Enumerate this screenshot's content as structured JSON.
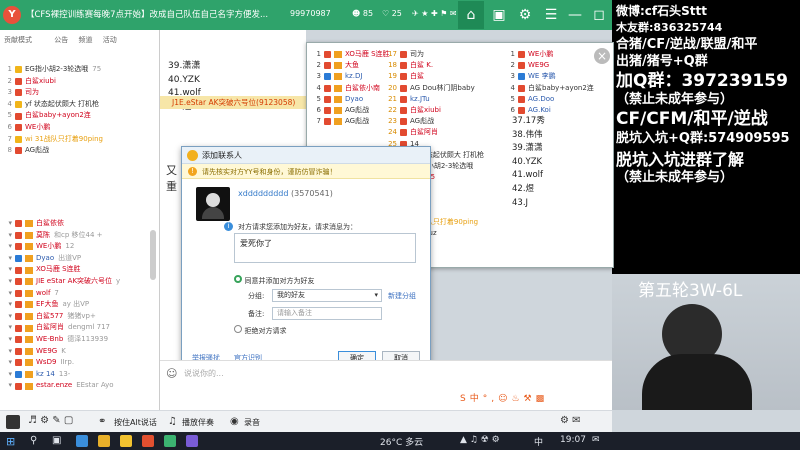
{
  "app": {
    "logo": "Y",
    "title": "【CFS裸控训练赛每晚7点开始】改成自己队伍自己名字方便发...",
    "channel_id": "99970987",
    "viewers": "85",
    "sub_count": "25"
  },
  "left_tabs": [
    "贡献模式",
    "公告",
    "频道",
    "活动"
  ],
  "left_top_rows": [
    {
      "rank": "1",
      "name": "EG指小胡2-3轮选哦",
      "extra": "75"
    },
    {
      "rank": "2",
      "name": "白鲨xiubi",
      "extra": ""
    },
    {
      "rank": "3",
      "name": "司为",
      "extra": ""
    },
    {
      "rank": "4",
      "name": "yf 状态起伏颇大 打机枪",
      "extra": ""
    },
    {
      "rank": "5",
      "name": "白鲨baby+ayon2连",
      "extra": ""
    },
    {
      "rank": "6",
      "name": "WE小鹏",
      "extra": ""
    },
    {
      "rank": "7",
      "name": "wi 31战队只打着90ping",
      "extra": ""
    },
    {
      "rank": "8",
      "name": "AG彪战",
      "extra": ""
    }
  ],
  "left_members": [
    {
      "name": "白鲨依依",
      "extra": ""
    },
    {
      "name": "莫陈",
      "extra": "和cp 移位44 +"
    },
    {
      "name": "WE小鹏",
      "extra": "12"
    },
    {
      "name": "Dyao",
      "extra": "出道VP"
    },
    {
      "name": "XO马鹿 S连胜",
      "extra": ""
    },
    {
      "name": "JIE eStar AK突破六号位",
      "extra": "y"
    },
    {
      "name": "wolf",
      "extra": "7"
    },
    {
      "name": "EF大鱼",
      "extra": "ay 出VP"
    },
    {
      "name": "白鲨577",
      "extra": "猪猪vp+"
    },
    {
      "name": "白鲨阿肖",
      "extra": "dengml 717"
    },
    {
      "name": "WE-Bnb",
      "extra": "德泽113939"
    },
    {
      "name": "WE9G",
      "extra": "K"
    },
    {
      "name": "WsD9",
      "extra": "IIrp."
    },
    {
      "name": "kz 14",
      "extra": "13-"
    },
    {
      "name": "estar.enze",
      "extra": "EEstar Ayo"
    }
  ],
  "chat": {
    "lines": [
      "39.潇潇",
      "40.YZK",
      "41.wolf",
      "42.煜"
    ],
    "highlight": "J1E.eStar AK突破六号位(9123058)",
    "side_text": [
      "又",
      "重"
    ]
  },
  "panel": {
    "col1": [
      {
        "n": "1",
        "name": "XO马鹿 S连胜"
      },
      {
        "n": "2",
        "name": "大鱼"
      },
      {
        "n": "3",
        "name": "kz.DJ"
      },
      {
        "n": "4",
        "name": "白鲨依小南"
      },
      {
        "n": "5",
        "name": "Dyao"
      },
      {
        "n": "6",
        "name": "AG彪战"
      },
      {
        "n": "7",
        "name": "AG彪战"
      }
    ],
    "col2": [
      {
        "n": "17",
        "name": "司为"
      },
      {
        "n": "18",
        "name": "白鲨 K."
      },
      {
        "n": "19",
        "name": "白鲨"
      },
      {
        "n": "20",
        "name": "AG Dou林门阴baby"
      },
      {
        "n": "21",
        "name": "kz.JTu"
      },
      {
        "n": "22",
        "name": "白鲨xiubi"
      },
      {
        "n": "23",
        "name": "AG彪战"
      },
      {
        "n": "24",
        "name": "白鲨阿肖"
      },
      {
        "n": "25",
        "name": "14"
      },
      {
        "n": "26",
        "name": "yf 状态起伏颇大 打机枪"
      },
      {
        "n": "27",
        "name": "EG指小胡2-3轮选哦"
      },
      {
        "n": "28",
        "name": "白鲨 15"
      },
      {
        "n": "29",
        "name": ""
      },
      {
        "n": "30",
        "name": ""
      },
      {
        "n": "31",
        "name": ""
      },
      {
        "n": "32",
        "name": "31战队只打着90ping"
      },
      {
        "n": "33",
        "name": "白鲨Ruz"
      },
      {
        "n": "34",
        "name": ""
      }
    ],
    "col3": [
      {
        "n": "1",
        "name": "WE小鹏"
      },
      {
        "n": "2",
        "name": "WE9G"
      },
      {
        "n": "3",
        "name": "WE 李鹏"
      },
      {
        "n": "4",
        "name": "白鲨baby+ayon2连"
      },
      {
        "n": "5",
        "name": "AG.Doo"
      },
      {
        "n": "6",
        "name": "AG.Koi"
      }
    ],
    "list": [
      "37.17秀",
      "38.伟伟",
      "39.潇潇",
      "40.YZK",
      "41.wolf",
      "42.煜",
      "43.J"
    ]
  },
  "stream": {
    "lines": [
      "微博:cf石头Sttt",
      "木友群:836325744",
      "合猪/CF/逆战/联盟/和平",
      "出猪/猪号+Q群",
      "加Q群：397239159",
      "（禁止未成年参与）",
      "CF/CFM/和平/逆战",
      "脱坑入坑+Q群:574909595",
      "脱坑入坑进群了解",
      "（禁止未成年参与）"
    ],
    "round": "第五轮3W-6L"
  },
  "dialog": {
    "title": "添加联系人",
    "warning": "请先核实对方YY号和身份，谨防仿冒诈骗！",
    "username": "xddddddddd",
    "uid": "(3570541)",
    "prompt": "对方请求您添加为好友，请求消息为：",
    "message": "爱死你了",
    "option_agree": "同意并添加对方为好友",
    "group_label": "分组:",
    "group_value": "我的好友",
    "new_group": "新建分组",
    "remark_label": "备注:",
    "remark_placeholder": "请输入备注",
    "option_reject": "拒绝对方请求",
    "report": "举报骚扰",
    "official": "官方识别",
    "ok": "确定",
    "cancel": "取消"
  },
  "chatbar": {
    "placeholder": "说说你的..."
  },
  "bottombar": {
    "mic": "按住Alt说话",
    "play": "播放伴奏",
    "sound": "录音"
  },
  "taskbar": {
    "weather": "26°C 多云",
    "ime": "中",
    "time": "19:07"
  }
}
